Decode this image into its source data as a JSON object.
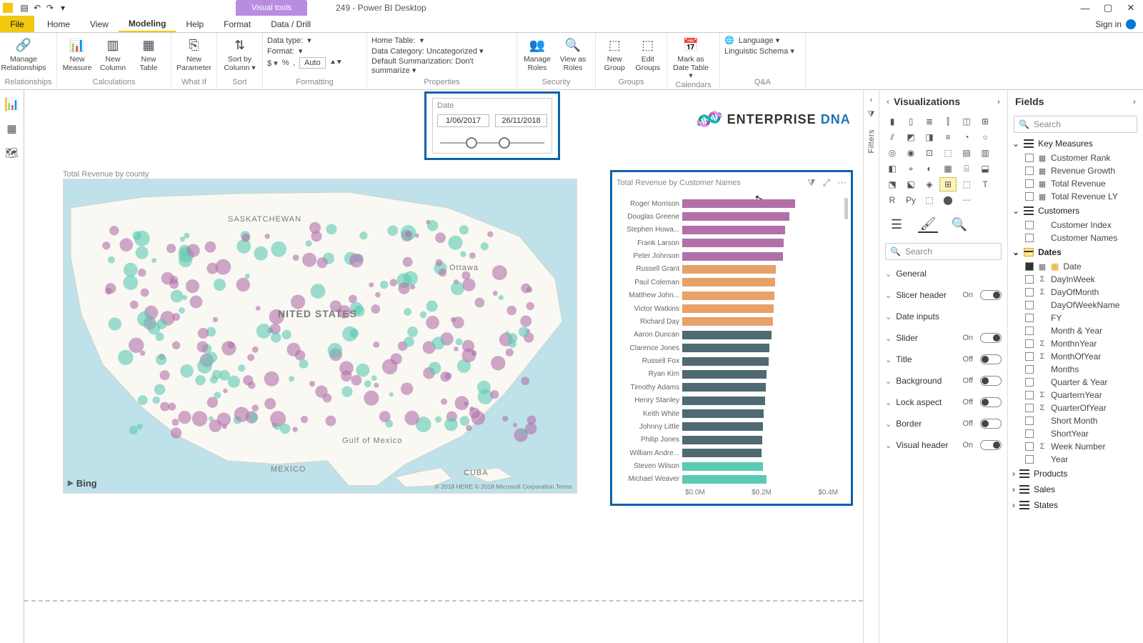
{
  "titlebar": {
    "context_tab": "Visual tools",
    "title": "249 - Power BI Desktop",
    "signin": "Sign in"
  },
  "tabs": {
    "file": "File",
    "items": [
      "Home",
      "View",
      "Modeling",
      "Help",
      "Format",
      "Data / Drill"
    ],
    "active": "Modeling"
  },
  "ribbon": {
    "relationships": {
      "manage": "Manage\nRelationships",
      "group": "Relationships"
    },
    "calculations": {
      "measure": "New\nMeasure",
      "column": "New\nColumn",
      "table": "New\nTable",
      "group": "Calculations"
    },
    "whatif": {
      "param": "New\nParameter",
      "group": "What If"
    },
    "sort": {
      "sortby": "Sort by\nColumn ▾",
      "group": "Sort"
    },
    "formatting": {
      "data_type_lbl": "Data type:",
      "data_type_val": "▾",
      "format_lbl": "Format:",
      "format_val": "▾",
      "auto": "Auto",
      "group": "Formatting",
      "symbols": [
        "$ ▾",
        "%",
        "‚",
        "Auto",
        "⯅",
        "⯆"
      ]
    },
    "properties": {
      "home_table": "Home Table:",
      "home_table_val": "▾",
      "data_cat": "Data Category: Uncategorized ▾",
      "summ": "Default Summarization: Don't summarize ▾",
      "group": "Properties"
    },
    "security": {
      "manage_roles": "Manage\nRoles",
      "view_as": "View as\nRoles",
      "group": "Security"
    },
    "groups": {
      "new": "New\nGroup",
      "edit": "Edit\nGroups",
      "group": "Groups"
    },
    "calendars": {
      "mark": "Mark as\nDate Table ▾",
      "group": "Calendars"
    },
    "qa": {
      "lang": "Language ▾",
      "schema": "Linguistic Schema ▾",
      "group": "Q&A"
    }
  },
  "filters_pane_label": "Filters",
  "viz_pane": {
    "title": "Visualizations",
    "search_placeholder": "Search",
    "format_sections": [
      {
        "name": "General",
        "toggle": null
      },
      {
        "name": "Slicer header",
        "toggle": "On"
      },
      {
        "name": "Date inputs",
        "toggle": null
      },
      {
        "name": "Slider",
        "toggle": "On"
      },
      {
        "name": "Title",
        "toggle": "Off"
      },
      {
        "name": "Background",
        "toggle": "Off"
      },
      {
        "name": "Lock aspect",
        "toggle": "Off"
      },
      {
        "name": "Border",
        "toggle": "Off"
      },
      {
        "name": "Visual header",
        "toggle": "On"
      }
    ]
  },
  "fields_pane": {
    "title": "Fields",
    "search_placeholder": "Search",
    "tables": [
      {
        "name": "Key Measures",
        "icon": "table",
        "expanded": true,
        "fields": [
          {
            "name": "Customer Rank",
            "sig": "▦"
          },
          {
            "name": "Revenue Growth",
            "sig": "▦"
          },
          {
            "name": "Total Revenue",
            "sig": "▦"
          },
          {
            "name": "Total Revenue LY",
            "sig": "▦"
          }
        ]
      },
      {
        "name": "Customers",
        "icon": "table",
        "expanded": true,
        "fields": [
          {
            "name": "Customer Index",
            "sig": ""
          },
          {
            "name": "Customer Names",
            "sig": ""
          }
        ]
      },
      {
        "name": "Dates",
        "icon": "calendar",
        "expanded": true,
        "bold": true,
        "fields": [
          {
            "name": "Date",
            "sig": "▦",
            "cal": true,
            "checked": true
          },
          {
            "name": "DayInWeek",
            "sig": "Σ"
          },
          {
            "name": "DayOfMonth",
            "sig": "Σ"
          },
          {
            "name": "DayOfWeekName",
            "sig": ""
          },
          {
            "name": "FY",
            "sig": ""
          },
          {
            "name": "Month & Year",
            "sig": ""
          },
          {
            "name": "MonthnYear",
            "sig": "Σ"
          },
          {
            "name": "MonthOfYear",
            "sig": "Σ"
          },
          {
            "name": "Months",
            "sig": ""
          },
          {
            "name": "Quarter & Year",
            "sig": ""
          },
          {
            "name": "QuarternYear",
            "sig": "Σ"
          },
          {
            "name": "QuarterOfYear",
            "sig": "Σ"
          },
          {
            "name": "Short Month",
            "sig": ""
          },
          {
            "name": "ShortYear",
            "sig": ""
          },
          {
            "name": "Week Number",
            "sig": "Σ"
          },
          {
            "name": "Year",
            "sig": ""
          }
        ]
      },
      {
        "name": "Products",
        "icon": "table",
        "expanded": false
      },
      {
        "name": "Sales",
        "icon": "table",
        "expanded": false
      },
      {
        "name": "States",
        "icon": "table",
        "expanded": false
      }
    ]
  },
  "slicer": {
    "label": "Date",
    "from": "1/06/2017",
    "to": "26/11/2018"
  },
  "logo": {
    "word1": "ENTERPRISE",
    "word2": "DNA"
  },
  "map_card": {
    "title": "Total Revenue by county",
    "labels": {
      "us": "NITED STATES",
      "mexico": "MEXICO",
      "cuba": "CUBA",
      "gulf": "Gulf of Mexico",
      "ottawa": "Ottawa",
      "sask": "SASKATCHEWAN",
      "bing": "Bing",
      "credits": "© 2018 HERE © 2018 Microsoft Corporation  Terms"
    }
  },
  "chart_data": {
    "type": "bar",
    "title": "Total Revenue by Customer Names",
    "xlabel": "",
    "ylabel": "",
    "xlim": [
      0,
      0.4
    ],
    "x_ticks": [
      "$0.0M",
      "$0.2M",
      "$0.4M"
    ],
    "categories": [
      "Roger Morrison",
      "Douglas Greene",
      "Stephen Howa...",
      "Frank Larson",
      "Peter Johnson",
      "Russell Grant",
      "Paul Coleman",
      "Matthew John...",
      "Victor Watkins",
      "Richard Day",
      "Aaron Duncan",
      "Clarence Jones",
      "Russell Fox",
      "Ryan Kim",
      "Timothy Adams",
      "Henry Stanley",
      "Keith White",
      "Johnny Little",
      "Philip Jones",
      "William Andre...",
      "Steven Wilson",
      "Michael Weaver"
    ],
    "values": [
      0.3,
      0.285,
      0.275,
      0.27,
      0.268,
      0.25,
      0.248,
      0.245,
      0.243,
      0.242,
      0.238,
      0.232,
      0.23,
      0.225,
      0.222,
      0.22,
      0.218,
      0.215,
      0.213,
      0.212,
      0.215,
      0.225
    ],
    "colors": [
      "purple",
      "purple",
      "purple",
      "purple",
      "purple",
      "orange",
      "orange",
      "orange",
      "orange",
      "orange",
      "slate",
      "slate",
      "slate",
      "slate",
      "slate",
      "slate",
      "slate",
      "slate",
      "slate",
      "slate",
      "teal",
      "teal"
    ]
  }
}
